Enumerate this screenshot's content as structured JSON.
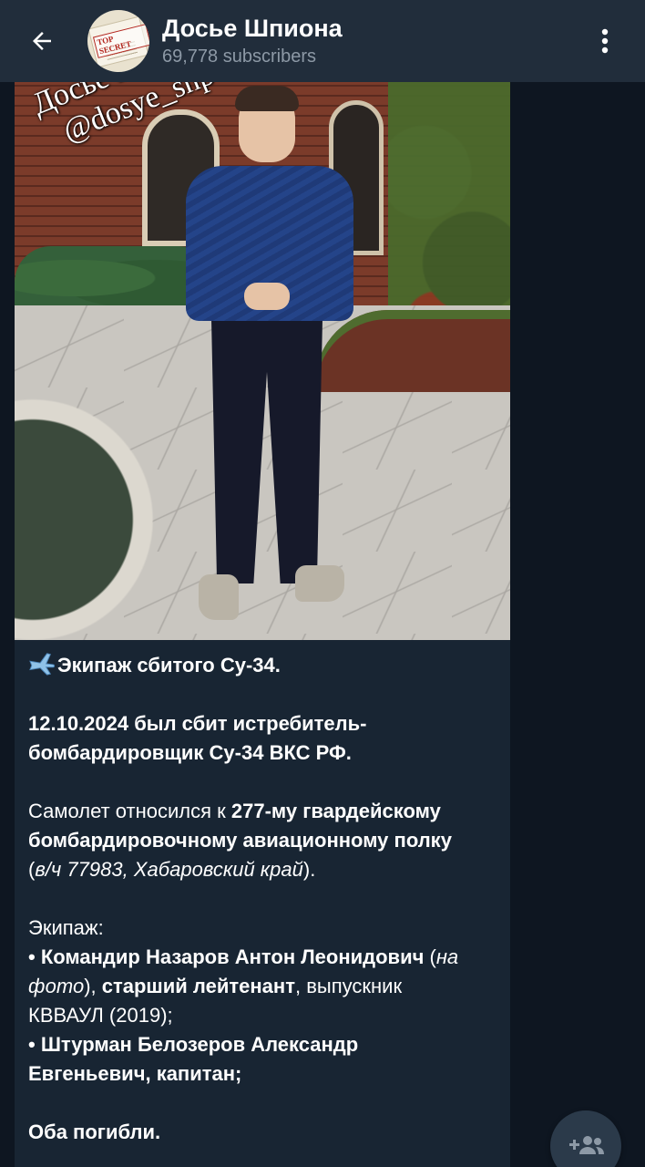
{
  "header": {
    "title": "Досье Шпиона",
    "subtitle": "69,778 subscribers",
    "avatar_stamp": "TOP SECRET"
  },
  "icons": {
    "back": "arrow-left-icon",
    "menu": "more-vertical-icon",
    "join": "add-person-icon",
    "emoji": "airplane-icon"
  },
  "photo": {
    "watermark_line1": "Досье Шп",
    "watermark_line2": "@dosye_shp"
  },
  "message": {
    "line1": "Экипаж сбитого Су-34.",
    "p2a": "12.10.2024 был сбит истребитель-",
    "p2b": "бомбардировщик Су-34 ВКС РФ.",
    "p3_pre": "Самолет относился к ",
    "p3_bold1": "277-му гвардейскому",
    "p3_bold2": "бомбардировочному авиационному полку",
    "p3_open": "(",
    "p3_ital": "в/ч 77983, Хабаровский край",
    "p3_close": ").",
    "crew_label": "Экипаж:",
    "c1_bold": "• Командир Назаров Антон Леонидович",
    "c1_open": " (",
    "c1_ital1": "на",
    "c1_ital2": "фото",
    "c1_close": "), ",
    "c1_bold2": "старший лейтенант",
    "c1_rest": ", выпускник",
    "c1_rest2": "КВВАУЛ (2019);",
    "c2_bold1": "• Штурман Белозеров Александр",
    "c2_bold2": "Евгеньевич, капитан;",
    "final": "Оба погибли."
  },
  "colors": {
    "header_bg": "#212d3b",
    "chat_bg": "#0e1621",
    "bubble_bg": "#182533",
    "subtitle": "#8d99a6"
  }
}
